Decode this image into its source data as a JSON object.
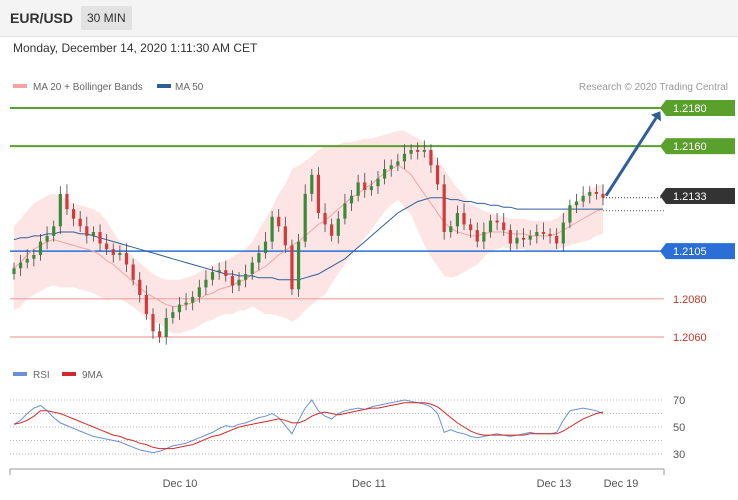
{
  "header": {
    "symbol": "EUR/USD",
    "timeframe": "30 MIN"
  },
  "timestamp": "Monday, December 14, 2020 1:11:30 AM CET",
  "colors": {
    "ma20": "#f4a3a3",
    "ma50": "#2f5e99",
    "band": "#fddede",
    "resistance": "#5aa02c",
    "support": "#2a6fd6",
    "support_secondary": "#f0a0a0",
    "bull": "#3a8a3a",
    "bear": "#d03a3a",
    "arrow": "#2f5e99",
    "rsi": "#6b8fd6",
    "rsi_ma": "#d22a2a",
    "price_tag": "#333333"
  },
  "chart_data": [
    {
      "type": "candlestick",
      "title": "",
      "legend": [
        {
          "name": "MA 20 + Bollinger Bands",
          "color": "#f4a3a3"
        },
        {
          "name": "MA 50",
          "color": "#2f5e99"
        }
      ],
      "legend_position": "top-left",
      "credit": "Research © 2020 Trading Central",
      "ylim": [
        1.205,
        1.219
      ],
      "current_price": "1.2133",
      "levels": [
        {
          "value": 1.218,
          "label": "1.2180",
          "style": "resistance"
        },
        {
          "value": 1.216,
          "label": "1.2160",
          "style": "resistance"
        },
        {
          "value": 1.2105,
          "label": "1.2105",
          "style": "pivot"
        },
        {
          "value": 1.208,
          "label": "1.2080",
          "style": "support"
        },
        {
          "value": 1.206,
          "label": "1.2060",
          "style": "support"
        }
      ],
      "close": [
        1.2096,
        1.2099,
        1.2101,
        1.2103,
        1.211,
        1.2113,
        1.2118,
        1.2135,
        1.2127,
        1.2122,
        1.2118,
        1.2113,
        1.2115,
        1.2109,
        1.2106,
        1.2103,
        1.2104,
        1.2098,
        1.209,
        1.2082,
        1.2072,
        1.2063,
        1.206,
        1.207,
        1.2073,
        1.2077,
        1.2078,
        1.2081,
        1.2086,
        1.209,
        1.2094,
        1.2095,
        1.2092,
        1.2087,
        1.209,
        1.2093,
        1.2099,
        1.2104,
        1.211,
        1.2123,
        1.2118,
        1.2108,
        1.2085,
        1.211,
        1.2135,
        1.2145,
        1.2125,
        1.2119,
        1.2113,
        1.2122,
        1.213,
        1.2134,
        1.2141,
        1.2137,
        1.2139,
        1.2143,
        1.2148,
        1.215,
        1.2152,
        1.2156,
        1.2158,
        1.2157,
        1.2158,
        1.215,
        1.214,
        1.2115,
        1.2118,
        1.2125,
        1.2119,
        1.2116,
        1.211,
        1.2115,
        1.2121,
        1.212,
        1.2116,
        1.2109,
        1.2112,
        1.2111,
        1.2113,
        1.2115,
        1.2114,
        1.2113,
        1.2109,
        1.212,
        1.2129,
        1.2131,
        1.2134,
        1.2136,
        1.2135,
        1.2133
      ],
      "ma20": [
        1.2096,
        1.2099,
        1.2103,
        1.2106,
        1.2108,
        1.211,
        1.2111,
        1.211,
        1.2109,
        1.2108,
        1.2107,
        1.2106,
        1.2105,
        1.2103,
        1.21,
        1.2098,
        1.2095,
        1.2092,
        1.2089,
        1.2086,
        1.2083,
        1.2081,
        1.2079,
        1.2077,
        1.2076,
        1.2076,
        1.2077,
        1.2078,
        1.208,
        1.2082,
        1.2083,
        1.2085,
        1.2086,
        1.2087,
        1.2089,
        1.209,
        1.2093,
        1.2095,
        1.2097,
        1.21,
        1.2103,
        1.2105,
        1.2108,
        1.211,
        1.2113,
        1.2116,
        1.2119,
        1.2121,
        1.2124,
        1.2127,
        1.213,
        1.2133,
        1.2135,
        1.2138,
        1.214,
        1.2143,
        1.2146,
        1.2148,
        1.215,
        1.2148,
        1.2145,
        1.214,
        1.2135,
        1.213,
        1.2125,
        1.212,
        1.2117,
        1.2115,
        1.2114,
        1.2113,
        1.2113,
        1.2114,
        1.2115,
        1.2115,
        1.2115,
        1.2114,
        1.2114,
        1.2114,
        1.2113,
        1.2113,
        1.2113,
        1.2113,
        1.2114,
        1.2116,
        1.2118,
        1.212,
        1.2122,
        1.2124,
        1.2126,
        1.2127
      ],
      "band_upper": [
        1.2118,
        1.2122,
        1.2126,
        1.213,
        1.2132,
        1.2134,
        1.2135,
        1.2134,
        1.2132,
        1.213,
        1.2129,
        1.2128,
        1.2127,
        1.2125,
        1.2121,
        1.2115,
        1.211,
        1.2106,
        1.2102,
        1.2099,
        1.2096,
        1.2093,
        1.2091,
        1.209,
        1.209,
        1.209,
        1.2091,
        1.2092,
        1.2094,
        1.2096,
        1.2097,
        1.2099,
        1.21,
        1.2102,
        1.2104,
        1.2106,
        1.211,
        1.2116,
        1.2122,
        1.2128,
        1.2135,
        1.214,
        1.2148,
        1.215,
        1.2152,
        1.2155,
        1.2158,
        1.216,
        1.216,
        1.2161,
        1.2162,
        1.2162,
        1.2163,
        1.2164,
        1.2164,
        1.2165,
        1.2166,
        1.2167,
        1.2168,
        1.2168,
        1.2166,
        1.2164,
        1.2162,
        1.2158,
        1.2153,
        1.2148,
        1.2143,
        1.2138,
        1.2134,
        1.213,
        1.2128,
        1.2126,
        1.2125,
        1.2124,
        1.2123,
        1.2122,
        1.2122,
        1.2122,
        1.2121,
        1.2121,
        1.2121,
        1.2121,
        1.2122,
        1.2125,
        1.2128,
        1.2131,
        1.2134,
        1.2137,
        1.2139,
        1.214
      ],
      "band_lower": [
        1.2074,
        1.2076,
        1.208,
        1.2082,
        1.2084,
        1.2086,
        1.2087,
        1.2086,
        1.2086,
        1.2086,
        1.2085,
        1.2084,
        1.2083,
        1.2081,
        1.2079,
        1.208,
        1.208,
        1.2078,
        1.2076,
        1.2073,
        1.207,
        1.2068,
        1.2067,
        1.2064,
        1.2062,
        1.2062,
        1.2063,
        1.2064,
        1.2066,
        1.2068,
        1.2069,
        1.2071,
        1.2072,
        1.2072,
        1.2074,
        1.2074,
        1.2076,
        1.2074,
        1.2072,
        1.2072,
        1.2071,
        1.207,
        1.2068,
        1.207,
        1.2074,
        1.2077,
        1.208,
        1.2082,
        1.2088,
        1.2093,
        1.2098,
        1.2104,
        1.2107,
        1.2112,
        1.2116,
        1.2121,
        1.2126,
        1.2129,
        1.2132,
        1.2128,
        1.2124,
        1.2116,
        1.2108,
        1.2102,
        1.2097,
        1.2092,
        1.2091,
        1.2092,
        1.2094,
        1.2096,
        1.2098,
        1.2102,
        1.2105,
        1.2106,
        1.2107,
        1.2106,
        1.2106,
        1.2106,
        1.2105,
        1.2105,
        1.2105,
        1.2105,
        1.2106,
        1.2107,
        1.2108,
        1.2109,
        1.211,
        1.2111,
        1.2113,
        1.2114
      ],
      "ma50": [
        1.2111,
        1.2112,
        1.2112,
        1.2113,
        1.2113,
        1.2114,
        1.2114,
        1.2115,
        1.2115,
        1.2115,
        1.2114,
        1.2114,
        1.2113,
        1.2112,
        1.2111,
        1.211,
        1.2109,
        1.2108,
        1.2107,
        1.2106,
        1.2105,
        1.2104,
        1.2103,
        1.2102,
        1.2101,
        1.21,
        1.2099,
        1.2098,
        1.2097,
        1.2096,
        1.2095,
        1.2094,
        1.2093,
        1.2093,
        1.2092,
        1.2092,
        1.2092,
        1.2091,
        1.2091,
        1.2091,
        1.209,
        1.209,
        1.209,
        1.209,
        1.2091,
        1.2092,
        1.2093,
        1.2095,
        1.2097,
        1.2099,
        1.2101,
        1.2104,
        1.2107,
        1.211,
        1.2113,
        1.2116,
        1.2119,
        1.2122,
        1.2125,
        1.2127,
        1.2129,
        1.2131,
        1.2132,
        1.2133,
        1.2133,
        1.2133,
        1.2132,
        1.2132,
        1.2131,
        1.2131,
        1.213,
        1.213,
        1.2129,
        1.2129,
        1.2128,
        1.2128,
        1.2127,
        1.2127,
        1.2127,
        1.2127,
        1.2127,
        1.2127,
        1.2127,
        1.2127,
        1.2127,
        1.2127,
        1.2127,
        1.2127,
        1.2127,
        1.2127
      ],
      "projection": {
        "from": 1.2133,
        "to": 1.218
      }
    },
    {
      "type": "line",
      "legend": [
        {
          "name": "RSI",
          "color": "#6b8fd6"
        },
        {
          "name": "9MA",
          "color": "#d22a2a"
        }
      ],
      "ylim": [
        25,
        75
      ],
      "y_ticks": [
        "70",
        "50",
        "30"
      ],
      "rsi": [
        52,
        55,
        60,
        64,
        66,
        62,
        57,
        53,
        51,
        49,
        47,
        45,
        43,
        42,
        41,
        40,
        39,
        37,
        35,
        33,
        32,
        31,
        32,
        34,
        36,
        37,
        38,
        40,
        42,
        44,
        46,
        49,
        51,
        50,
        52,
        53,
        55,
        57,
        58,
        60,
        57,
        51,
        45,
        55,
        64,
        70,
        62,
        58,
        56,
        60,
        62,
        63,
        64,
        63,
        65,
        66,
        67,
        68,
        69,
        70,
        69,
        68,
        67,
        65,
        60,
        46,
        48,
        46,
        45,
        43,
        42,
        43,
        44,
        45,
        44,
        43,
        44,
        45,
        46,
        45,
        45,
        45,
        46,
        55,
        62,
        63,
        64,
        63,
        62,
        60
      ],
      "rsi_ma": [
        52,
        53,
        55,
        58,
        62,
        62,
        61,
        60,
        58,
        56,
        54,
        52,
        50,
        48,
        46,
        44,
        43,
        41,
        40,
        38,
        37,
        35,
        34,
        34,
        34,
        35,
        36,
        37,
        39,
        41,
        43,
        44,
        46,
        48,
        50,
        51,
        52,
        53,
        54,
        55,
        56,
        55,
        53,
        53,
        55,
        58,
        60,
        61,
        60,
        59,
        60,
        61,
        62,
        63,
        64,
        64,
        65,
        66,
        67,
        68,
        68,
        68,
        68,
        67,
        65,
        61,
        57,
        53,
        50,
        47,
        45,
        44,
        44,
        44,
        44,
        44,
        44,
        44,
        45,
        45,
        45,
        45,
        45,
        47,
        50,
        53,
        56,
        58,
        60,
        61
      ]
    }
  ],
  "x_axis": {
    "tick_labels": [
      "Dec 10",
      "Dec 11",
      "Dec 13",
      "Dec 19"
    ]
  }
}
